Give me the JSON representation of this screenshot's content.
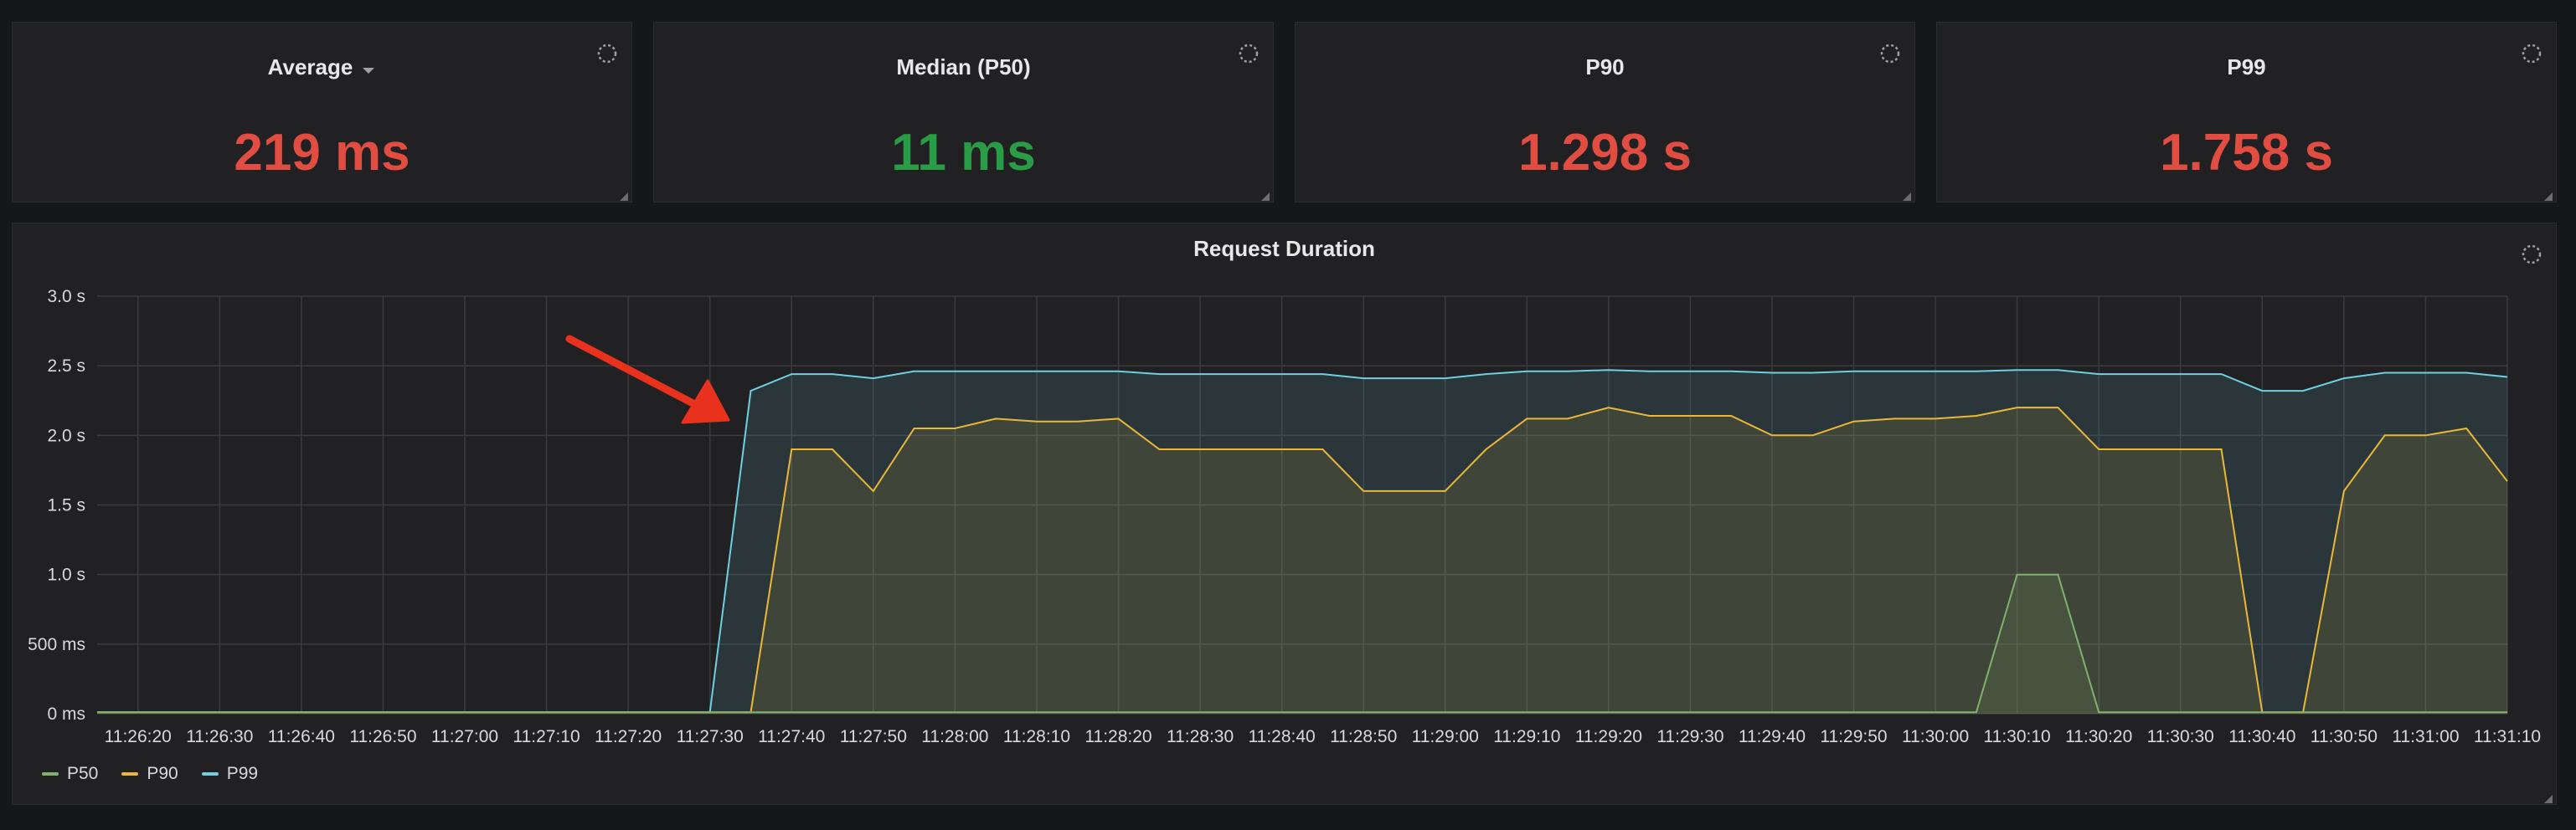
{
  "stats": [
    {
      "title": "Average",
      "has_dropdown": true,
      "value": "219 ms",
      "color": "#e24d42"
    },
    {
      "title": "Median (P50)",
      "has_dropdown": false,
      "value": "11 ms",
      "color": "#299c46"
    },
    {
      "title": "P90",
      "has_dropdown": false,
      "value": "1.298 s",
      "color": "#e24d42"
    },
    {
      "title": "P99",
      "has_dropdown": false,
      "value": "1.758 s",
      "color": "#e24d42"
    }
  ],
  "graph": {
    "title": "Request Duration"
  },
  "chart_data": {
    "type": "area",
    "title": "Request Duration",
    "xlabel": "",
    "ylabel": "",
    "ylim": [
      0,
      3.0
    ],
    "y_ticks": [
      "0 ms",
      "500 ms",
      "1.0 s",
      "1.5 s",
      "2.0 s",
      "2.5 s",
      "3.0 s"
    ],
    "x_ticks": [
      "11:26:20",
      "11:26:30",
      "11:26:40",
      "11:26:50",
      "11:27:00",
      "11:27:10",
      "11:27:20",
      "11:27:30",
      "11:27:40",
      "11:27:50",
      "11:28:00",
      "11:28:10",
      "11:28:20",
      "11:28:30",
      "11:28:40",
      "11:28:50",
      "11:29:00",
      "11:29:10",
      "11:29:20",
      "11:29:30",
      "11:29:40",
      "11:29:50",
      "11:30:00",
      "11:30:10",
      "11:30:20",
      "11:30:30",
      "11:30:40",
      "11:30:50",
      "11:31:00",
      "11:31:10"
    ],
    "x": [
      "11:26:15",
      "11:26:20",
      "11:26:25",
      "11:26:30",
      "11:26:35",
      "11:26:40",
      "11:26:45",
      "11:26:50",
      "11:26:55",
      "11:27:00",
      "11:27:05",
      "11:27:10",
      "11:27:15",
      "11:27:20",
      "11:27:25",
      "11:27:30",
      "11:27:35",
      "11:27:40",
      "11:27:45",
      "11:27:50",
      "11:27:55",
      "11:28:00",
      "11:28:05",
      "11:28:10",
      "11:28:15",
      "11:28:20",
      "11:28:25",
      "11:28:30",
      "11:28:35",
      "11:28:40",
      "11:28:45",
      "11:28:50",
      "11:28:55",
      "11:29:00",
      "11:29:05",
      "11:29:10",
      "11:29:15",
      "11:29:20",
      "11:29:25",
      "11:29:30",
      "11:29:35",
      "11:29:40",
      "11:29:45",
      "11:29:50",
      "11:29:55",
      "11:30:00",
      "11:30:05",
      "11:30:10",
      "11:30:15",
      "11:30:20",
      "11:30:25",
      "11:30:30",
      "11:30:35",
      "11:30:40",
      "11:30:45",
      "11:30:50",
      "11:30:55",
      "11:31:00",
      "11:31:05",
      "11:31:10"
    ],
    "series": [
      {
        "name": "P50",
        "color": "#7eb26d",
        "values": [
          0.01,
          0.01,
          0.01,
          0.01,
          0.01,
          0.01,
          0.01,
          0.01,
          0.01,
          0.01,
          0.01,
          0.01,
          0.01,
          0.01,
          0.01,
          0.01,
          0.01,
          0.01,
          0.01,
          0.01,
          0.01,
          0.01,
          0.01,
          0.01,
          0.01,
          0.01,
          0.01,
          0.01,
          0.01,
          0.01,
          0.01,
          0.01,
          0.01,
          0.01,
          0.01,
          0.01,
          0.01,
          0.01,
          0.01,
          0.01,
          0.01,
          0.01,
          0.01,
          0.01,
          0.01,
          0.01,
          0.01,
          1.0,
          1.0,
          0.01,
          0.01,
          0.01,
          0.01,
          0.01,
          0.01,
          0.01,
          0.01,
          0.01,
          0.01,
          0.01
        ]
      },
      {
        "name": "P90",
        "color": "#eab839",
        "values": [
          0.01,
          0.01,
          0.01,
          0.01,
          0.01,
          0.01,
          0.01,
          0.01,
          0.01,
          0.01,
          0.01,
          0.01,
          0.01,
          0.01,
          0.01,
          0.01,
          0.01,
          1.9,
          1.9,
          1.6,
          2.05,
          2.05,
          2.12,
          2.1,
          2.1,
          2.12,
          1.9,
          1.9,
          1.9,
          1.9,
          1.9,
          1.6,
          1.6,
          1.6,
          1.9,
          2.12,
          2.12,
          2.2,
          2.14,
          2.14,
          2.14,
          2.0,
          2.0,
          2.1,
          2.12,
          2.12,
          2.14,
          2.2,
          2.2,
          1.9,
          1.9,
          1.9,
          1.9,
          0.01,
          0.01,
          1.6,
          2.0,
          2.0,
          2.05,
          1.67
        ]
      },
      {
        "name": "P99",
        "color": "#6ed0e0",
        "values": [
          0.01,
          0.01,
          0.01,
          0.01,
          0.01,
          0.01,
          0.01,
          0.01,
          0.01,
          0.01,
          0.01,
          0.01,
          0.01,
          0.01,
          0.01,
          0.01,
          2.32,
          2.44,
          2.44,
          2.41,
          2.46,
          2.46,
          2.46,
          2.46,
          2.46,
          2.46,
          2.44,
          2.44,
          2.44,
          2.44,
          2.44,
          2.41,
          2.41,
          2.41,
          2.44,
          2.46,
          2.46,
          2.47,
          2.46,
          2.46,
          2.46,
          2.45,
          2.45,
          2.46,
          2.46,
          2.46,
          2.46,
          2.47,
          2.47,
          2.44,
          2.44,
          2.44,
          2.44,
          2.32,
          2.32,
          2.41,
          2.45,
          2.45,
          2.45,
          2.42
        ]
      }
    ],
    "grid": true,
    "legend_position": "bottom-left"
  },
  "annotation": {
    "type": "arrow",
    "color": "#e8321e"
  }
}
